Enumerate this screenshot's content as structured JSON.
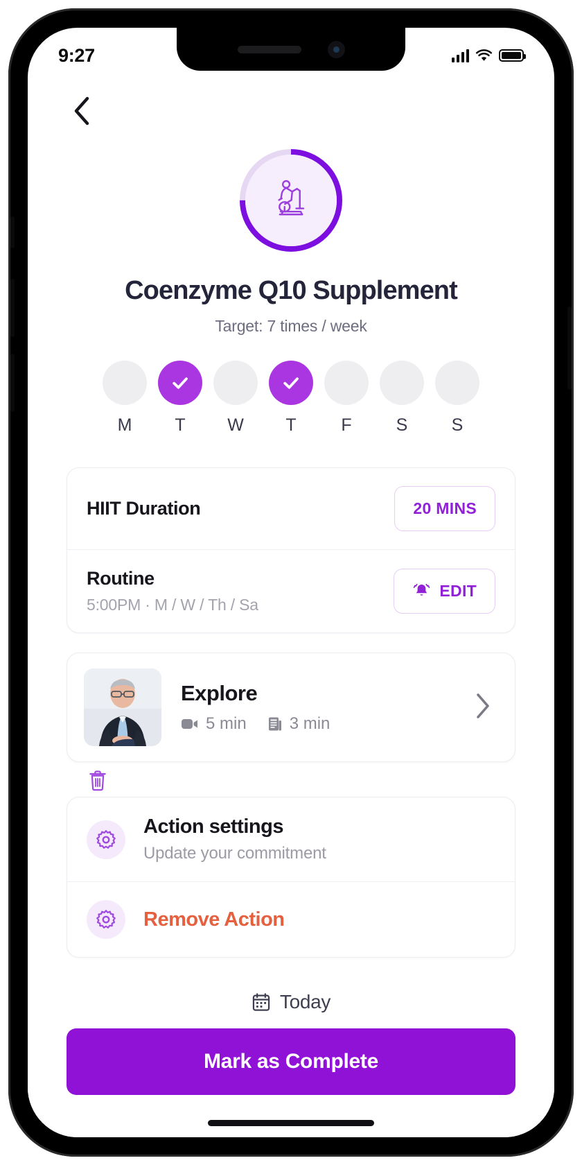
{
  "status_bar": {
    "time": "9:27",
    "signal_icon": "cellular-signal-icon",
    "wifi_icon": "wifi-icon",
    "battery_icon": "battery-icon"
  },
  "header": {
    "back_icon": "chevron-left-icon"
  },
  "hero": {
    "progress_percent": 75,
    "ring_color": "#7c0ee0",
    "ring_track_color": "#e6d8f2",
    "icon_background": "#f6eefc",
    "habit_icon": "stationary-bike-icon",
    "title": "Coenzyme Q10 Supplement",
    "target": "Target: 7 times / week"
  },
  "week_strip": {
    "days": [
      {
        "label": "M",
        "completed": false
      },
      {
        "label": "T",
        "completed": true
      },
      {
        "label": "W",
        "completed": false
      },
      {
        "label": "T",
        "completed": true
      },
      {
        "label": "F",
        "completed": false
      },
      {
        "label": "S",
        "completed": false
      },
      {
        "label": "S",
        "completed": false
      }
    ],
    "completed_color": "#a936e0",
    "empty_color": "#eeeef0",
    "check_icon": "check-icon"
  },
  "settings_card": {
    "duration_row": {
      "title": "HIIT Duration",
      "button_label": "20 MINS"
    },
    "routine_row": {
      "title": "Routine",
      "subtitle": "5:00PM · M / W / Th / Sa",
      "button_label": "EDIT",
      "button_icon": "bell-ringing-icon"
    }
  },
  "explore_card": {
    "thumbnail": "person-photo",
    "title": "Explore",
    "video_icon": "video-camera-icon",
    "video_duration": "5 min",
    "article_icon": "article-icon",
    "article_duration": "3 min",
    "chevron_icon": "chevron-right-icon"
  },
  "trash": {
    "icon": "trash-icon",
    "color": "#a04ae0"
  },
  "actions_card": {
    "items": [
      {
        "icon": "gear-icon",
        "title": "Action settings",
        "subtitle": "Update your commitment",
        "danger": false
      },
      {
        "icon": "gear-icon",
        "title": "Remove Action",
        "subtitle": "",
        "danger": true
      }
    ],
    "danger_color": "#e4603f"
  },
  "footer": {
    "today_icon": "calendar-icon",
    "today_label": "Today",
    "cta_label": "Mark as Complete",
    "cta_color": "#9012d6"
  }
}
